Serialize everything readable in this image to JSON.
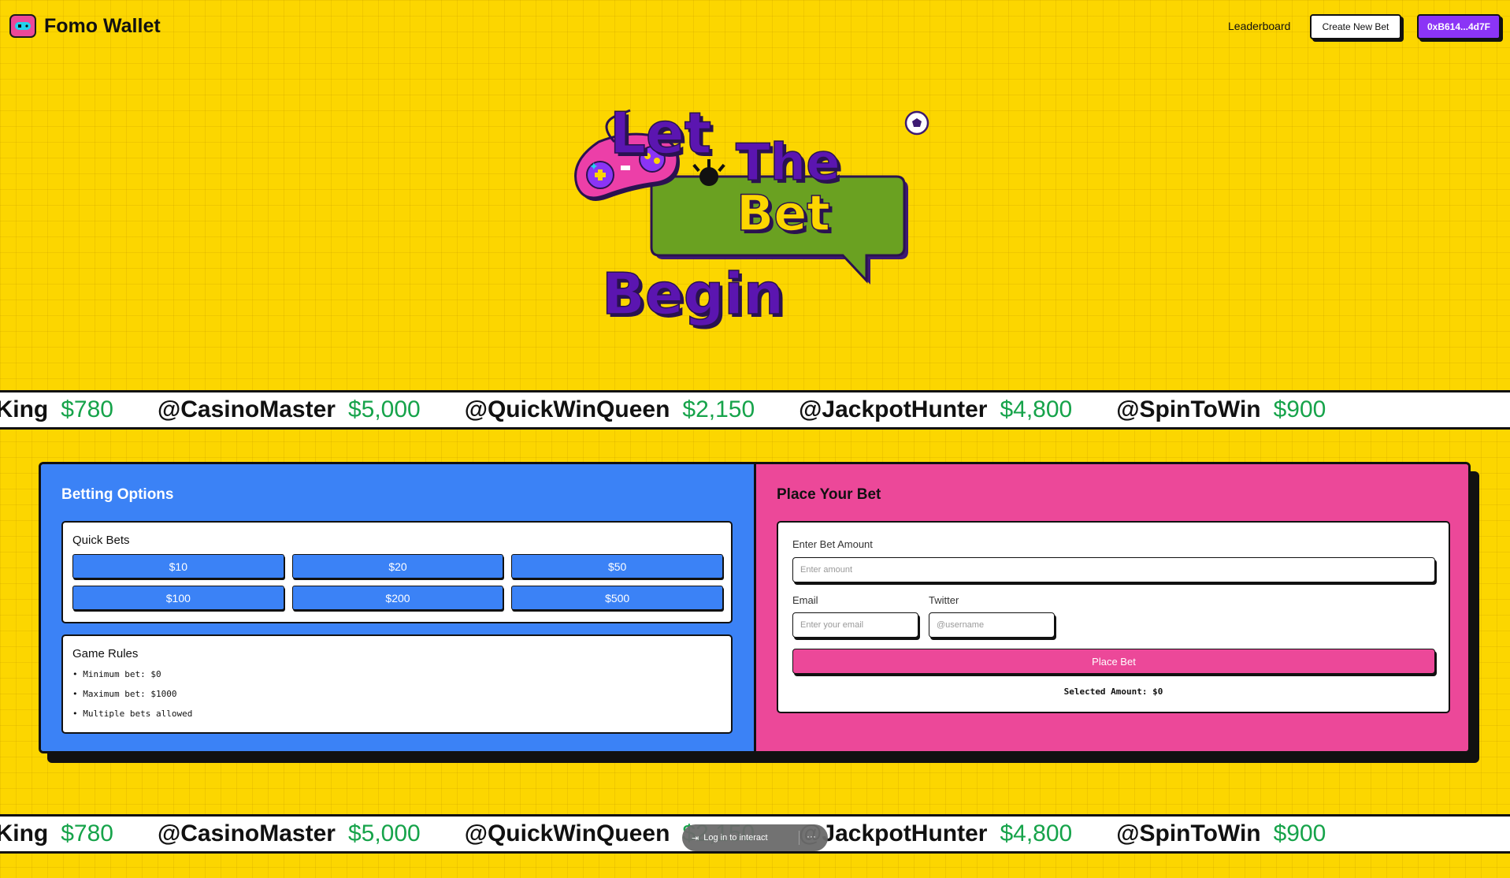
{
  "header": {
    "brand": "Fomo Wallet",
    "brand_icon": "gamepad-icon",
    "nav_leaderboard": "Leaderboard",
    "create_bet": "Create New Bet",
    "wallet_address": "0xB614...4d7F"
  },
  "hero": {
    "line1_a": "Let",
    "line1_b": "The",
    "line2": "Bet",
    "line3": "Begin"
  },
  "ticker": {
    "items": [
      {
        "user": "@BettingKing",
        "amount": "$780"
      },
      {
        "user": "@CasinoMaster",
        "amount": "$5,000"
      },
      {
        "user": "@QuickWinQueen",
        "amount": "$2,150"
      },
      {
        "user": "@JackpotHunter",
        "amount": "$4,800"
      },
      {
        "user": "@SpinToWin",
        "amount": "$900"
      }
    ]
  },
  "betting_options": {
    "title": "Betting Options",
    "quick_bets_label": "Quick Bets",
    "quick_bets": [
      "$10",
      "$20",
      "$50",
      "$100",
      "$200",
      "$500"
    ],
    "rules_label": "Game Rules",
    "rules": [
      "Minimum bet: $0",
      "Maximum bet: $1000",
      "Multiple bets allowed"
    ]
  },
  "place_bet": {
    "title": "Place Your Bet",
    "amount_label": "Enter Bet Amount",
    "amount_placeholder": "Enter amount",
    "email_label": "Email",
    "email_placeholder": "Enter your email",
    "twitter_label": "Twitter",
    "twitter_placeholder": "@username",
    "button": "Place Bet",
    "selected_amount": "Selected Amount: $0"
  },
  "overlay": {
    "login_text": "Log in to interact",
    "more": "···"
  },
  "colors": {
    "background": "#fcd600",
    "blue_panel": "#3b82f6",
    "pink_panel": "#ec4899",
    "wallet_purple": "#8b34f6",
    "ticker_green": "#16a34a",
    "hero_purple": "#5b15b0",
    "hero_green": "#6aa121"
  }
}
